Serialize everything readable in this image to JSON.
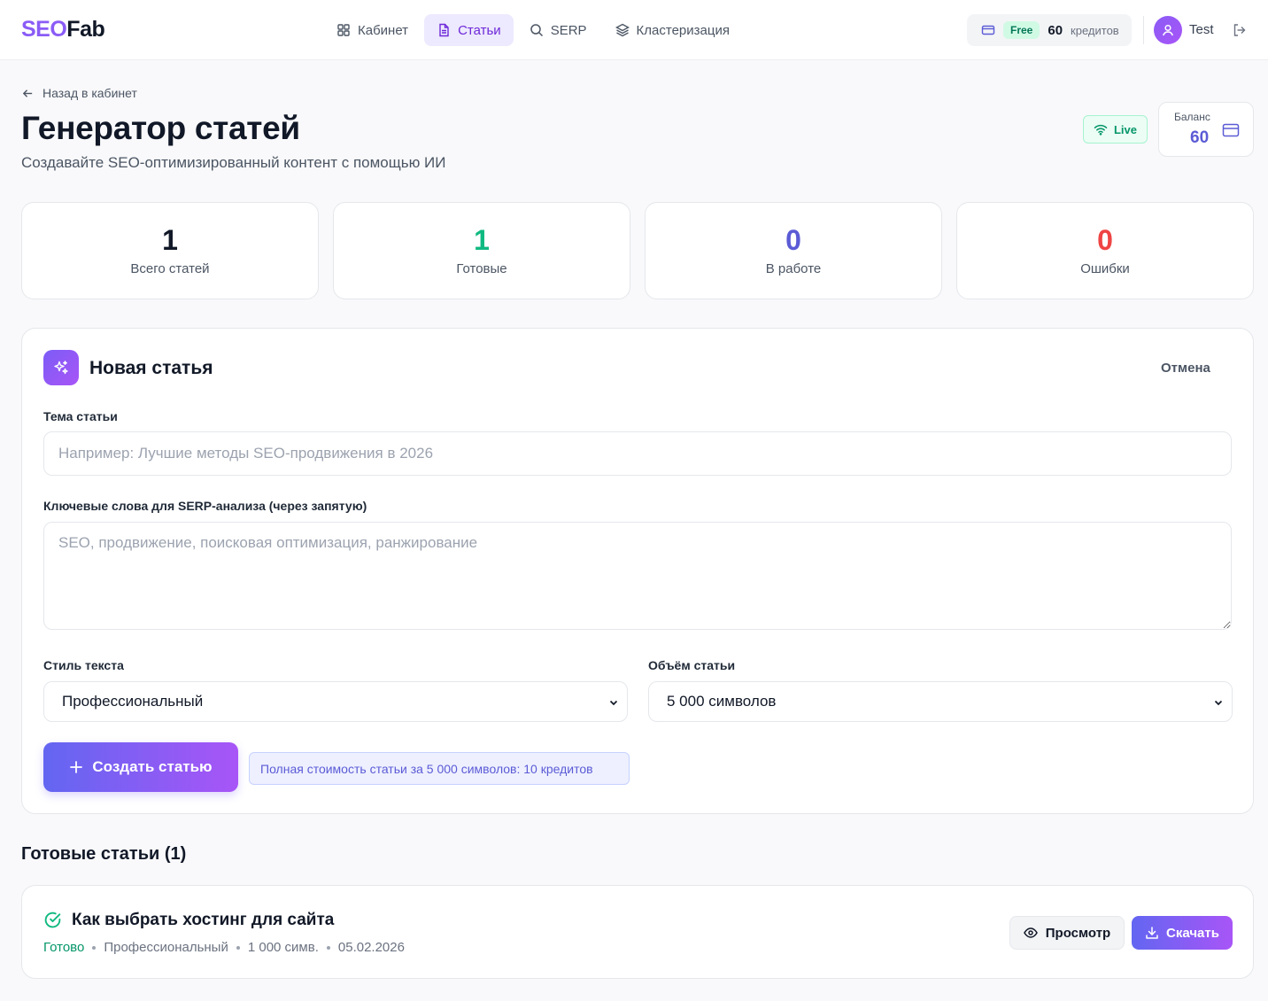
{
  "brand": {
    "part1": "SEO",
    "part2": "Fab"
  },
  "nav": {
    "items": [
      {
        "label": "Кабинет",
        "icon": "grid-icon"
      },
      {
        "label": "Статьи",
        "icon": "document-icon",
        "active": true
      },
      {
        "label": "SERP",
        "icon": "search-icon"
      },
      {
        "label": "Кластеризация",
        "icon": "layers-icon"
      }
    ],
    "plan": "Free",
    "credits": "60",
    "credits_unit": "кредитов",
    "user": "Test"
  },
  "header": {
    "back": "Назад в кабинет",
    "title": "Генератор статей",
    "subtitle": "Создавайте SEO-оптимизированный контент с помощью ИИ",
    "live": "Live",
    "balance_label": "Баланс",
    "balance_value": "60"
  },
  "stats": [
    {
      "value": "1",
      "label": "Всего статей",
      "color": "#111827"
    },
    {
      "value": "1",
      "label": "Готовые",
      "color": "#10b981"
    },
    {
      "value": "0",
      "label": "В работе",
      "color": "#5b5bd6"
    },
    {
      "value": "0",
      "label": "Ошибки",
      "color": "#ef4444"
    }
  ],
  "form": {
    "title": "Новая статья",
    "cancel": "Отмена",
    "topic_label": "Тема статьи",
    "topic_placeholder": "Например: Лучшие методы SEO-продвижения в 2026",
    "keywords_label": "Ключевые слова для SERP-анализа (через запятую)",
    "keywords_placeholder": "SEO, продвижение, поисковая оптимизация, ранжирование",
    "style_label": "Стиль текста",
    "style_value": "Профессиональный",
    "volume_label": "Объём статьи",
    "volume_value": "5 000 символов",
    "submit": "Создать статью",
    "cost_note": "Полная стоимость статьи за 5 000 символов: 10 кредитов"
  },
  "ready": {
    "title": "Готовые статьи (1)",
    "items": [
      {
        "title": "Как выбрать хостинг для сайта",
        "status": "Готово",
        "style": "Профессиональный",
        "length": "1 000 симв.",
        "date": "05.02.2026",
        "view": "Просмотр",
        "download": "Скачать"
      }
    ]
  },
  "colors": {
    "accent": "#8b5cf6",
    "success": "#10b981",
    "indigo": "#5b5bd6",
    "error": "#ef4444"
  }
}
